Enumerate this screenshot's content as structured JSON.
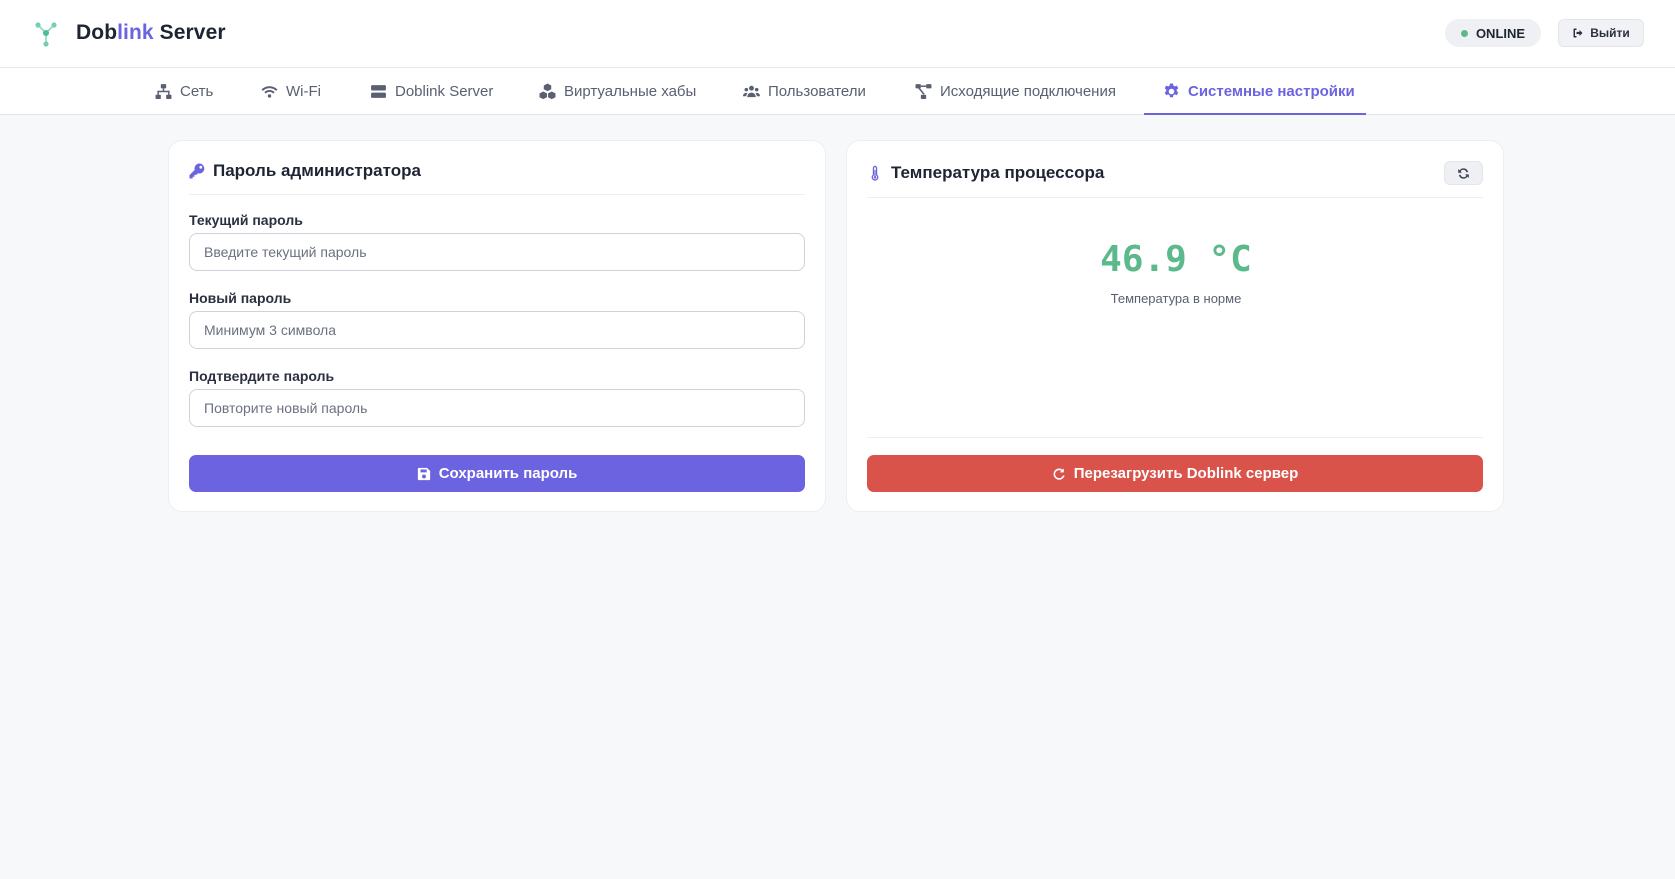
{
  "header": {
    "brand_part1": "Dob",
    "brand_part2": "link",
    "brand_part3": " Server",
    "status": "ONLINE",
    "logout_label": "Выйти"
  },
  "nav": {
    "tabs": [
      {
        "label": "Сеть",
        "icon": "network-icon"
      },
      {
        "label": "Wi-Fi",
        "icon": "wifi-icon"
      },
      {
        "label": "Doblink Server",
        "icon": "server-icon"
      },
      {
        "label": "Виртуальные хабы",
        "icon": "cubes-icon"
      },
      {
        "label": "Пользователи",
        "icon": "users-icon"
      },
      {
        "label": "Исходящие подключения",
        "icon": "connections-icon"
      },
      {
        "label": "Системные настройки",
        "icon": "gear-icon",
        "active": true
      }
    ]
  },
  "password_card": {
    "title": "Пароль администратора",
    "current_label": "Текущий пароль",
    "current_placeholder": "Введите текущий пароль",
    "new_label": "Новый пароль",
    "new_placeholder": "Минимум 3 символа",
    "confirm_label": "Подтвердите пароль",
    "confirm_placeholder": "Повторите новый пароль",
    "save_label": "Сохранить пароль"
  },
  "temperature_card": {
    "title": "Температура процессора",
    "value": "46.9 °C",
    "status": "Температура в норме",
    "restart_label": "Перезагрузить Doblink сервер"
  },
  "colors": {
    "accent": "#6c63e0",
    "online": "#5bb98b",
    "temp_ok": "#5bb98b",
    "danger": "#d9534a"
  }
}
